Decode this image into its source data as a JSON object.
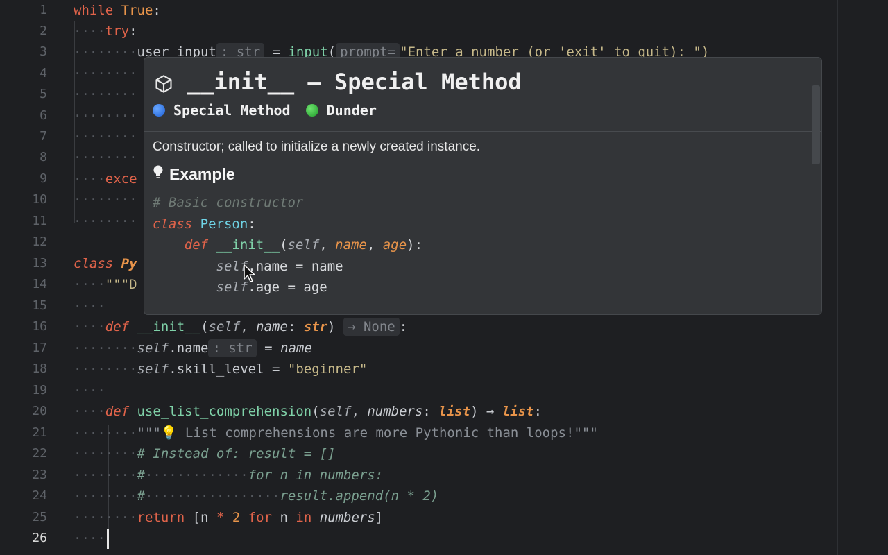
{
  "line_numbers": [
    "1",
    "2",
    "3",
    "4",
    "5",
    "6",
    "7",
    "8",
    "9",
    "10",
    "11",
    "12",
    "13",
    "14",
    "15",
    "16",
    "17",
    "18",
    "19",
    "20",
    "21",
    "22",
    "23",
    "24",
    "25",
    "26"
  ],
  "code": {
    "l1_kw": "while",
    "l1_true": "True",
    "l1_colon": ":",
    "l2_ws": "····",
    "l2_kw": "try",
    "l2_colon": ":",
    "l3_ws": "········",
    "l3_text": "user_input",
    "l3_hint": ": str",
    "l3_eq": " = ",
    "l3_fn": "input",
    "l3_paren": "(",
    "l3_hint2": "prompt=",
    "l3_str": "\"Enter a number (or 'exit' to quit): \")",
    "l4_ws": "········",
    "l5_ws": "········",
    "l6_ws": "········",
    "l7_ws": "········",
    "l8_ws": "········",
    "l9_ws": "····",
    "l9_kw": "exce",
    "l10_ws": "········",
    "l11_ws": "········",
    "l13_kw": "class",
    "l13_cls": "Py",
    "l14_ws": "····",
    "l14_str": "\"\"\"D",
    "l15_ws": "····",
    "l16_ws": "····",
    "l16_def": "def",
    "l16_fn": "__init__",
    "l16_open": "(",
    "l16_self": "self",
    "l16_sep": ", ",
    "l16_p": "name",
    "l16_colon": ": ",
    "l16_t": "str",
    "l16_close": ")",
    "l16_hint": "→ None",
    "l16_end": ":",
    "l17_ws": "········",
    "l17_self": "self",
    "l17_attr": ".name",
    "l17_hint": ": str",
    "l17_eq": " = ",
    "l17_p": "name",
    "l18_ws": "········",
    "l18_self": "self",
    "l18_attr": ".skill_level",
    "l18_eq": " = ",
    "l18_str": "\"beginner\"",
    "l19_ws": "····",
    "l20_ws": "····",
    "l20_def": "def",
    "l20_fn": "use_list_comprehension",
    "l20_open": "(",
    "l20_self": "self",
    "l20_sep": ", ",
    "l20_p": "numbers",
    "l20_colon": ": ",
    "l20_t": "list",
    "l20_close": ")",
    "l20_arrow": " → ",
    "l20_rt": "list",
    "l20_end": ":",
    "l21_ws": "········",
    "l21_str": "\"\"\"💡 List comprehensions are more Pythonic than loops!\"\"\"",
    "l22_ws": "········",
    "l22_cmt": "# Instead of: result = []",
    "l23_ws": "········",
    "l23_cmt1": "#",
    "l23_dots": "·············",
    "l23_cmt2": "for n in numbers:",
    "l24_ws": "········",
    "l24_cmt1": "#",
    "l24_dots": "·················",
    "l24_cmt2": "result.append(n * 2)",
    "l25_ws": "········",
    "l25_kw": "return",
    "l25_sp": " ",
    "l25_a": "[n ",
    "l25_op": "* ",
    "l25_num": "2",
    "l25_for": " for ",
    "l25_n": "n ",
    "l25_in": "in ",
    "l25_nums": "numbers",
    "l25_close": "]",
    "l26_ws": "····"
  },
  "popup": {
    "title": "__init__ – Special Method",
    "badge1": "Special Method",
    "badge2": "Dunder",
    "description": "Constructor; called to initialize a newly created instance.",
    "example_label": "Example",
    "ex_l1": "# Basic constructor",
    "ex_l2_kw": "class",
    "ex_l2_cls": "Person",
    "ex_l2_end": ":",
    "ex_l3_ind": "    ",
    "ex_l3_def": "def",
    "ex_l3_fn": "__init__",
    "ex_l3_open": "(",
    "ex_l3_self": "self",
    "ex_l3_sep1": ", ",
    "ex_l3_p1": "name",
    "ex_l3_sep2": ", ",
    "ex_l3_p2": "age",
    "ex_l3_end": "):",
    "ex_l4_ind": "        ",
    "ex_l4_self": "self",
    "ex_l4_rest": ".name",
    "ex_l4_eq": " = ",
    "ex_l4_val": "name",
    "ex_l5_ind": "        ",
    "ex_l5_self": "self",
    "ex_l5_rest": ".age",
    "ex_l5_eq": " = ",
    "ex_l5_val": "age"
  },
  "colors": {
    "background": "#1e1f22",
    "popup": "#333538",
    "keyword": "#e0634a",
    "function": "#7fd1a8",
    "type": "#e8944a",
    "string": "#c7b98a",
    "comment": "#7a9f8f"
  },
  "icons": [
    "cube-icon",
    "lightbulb-icon",
    "mouse-pointer-icon"
  ]
}
